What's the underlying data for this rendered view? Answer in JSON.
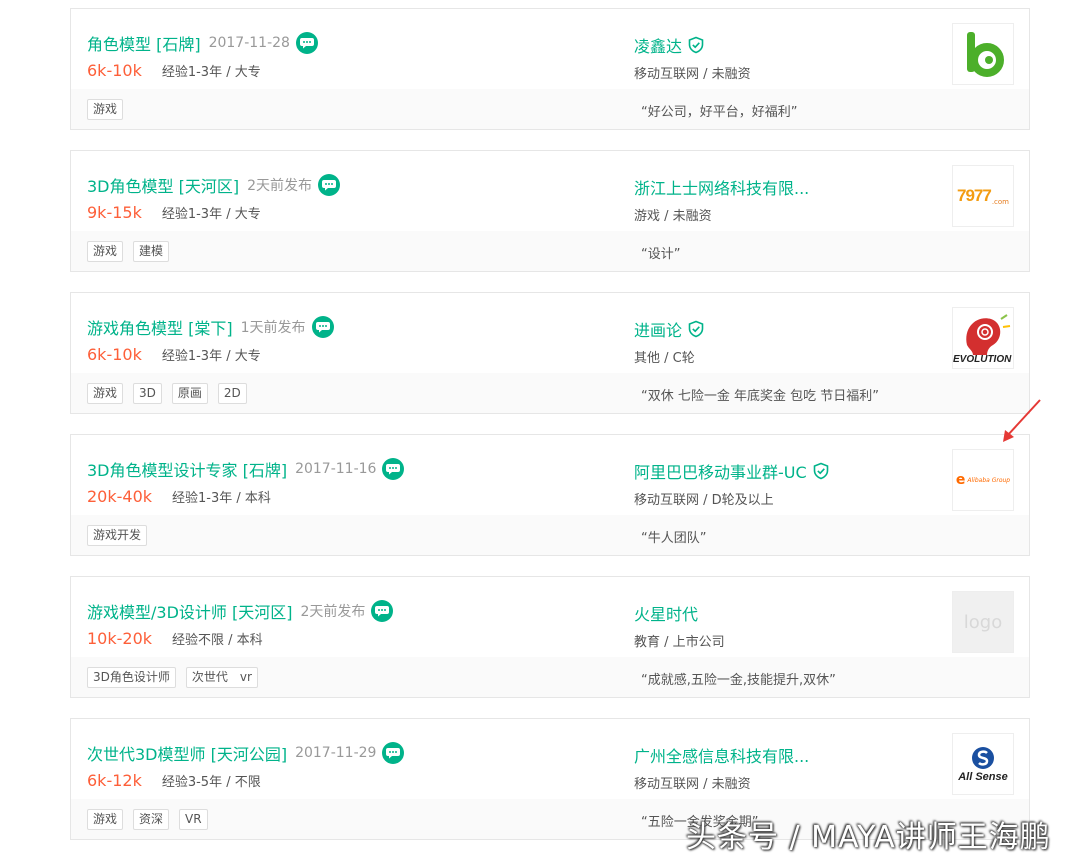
{
  "colors": {
    "accent": "#00b38a",
    "salary": "#fd5f39",
    "arrow": "#e53935"
  },
  "jobs": [
    {
      "position": "角色模型 [石牌]",
      "time": "2017-11-28",
      "salary": "6k-10k",
      "requirement": "经验1-3年 / 大专",
      "company": "凌鑫达",
      "verified": true,
      "industry": "移动互联网 / 未融资",
      "logo": "bc-green-logo",
      "tags": [
        "游戏"
      ],
      "slogan": "“好公司，好平台，好福利”"
    },
    {
      "position": "3D角色模型 [天河区]",
      "time": "2天前发布",
      "salary": "9k-15k",
      "requirement": "经验1-3年 / 大专",
      "company": "浙江上士网络科技有限...",
      "verified": false,
      "industry": "游戏 / 未融资",
      "logo": "7977-logo",
      "logo_text": "7977",
      "logo_sub": ".com",
      "tags": [
        "游戏",
        "建模"
      ],
      "slogan": "“设计”"
    },
    {
      "position": "游戏角色模型 [棠下]",
      "time": "1天前发布",
      "salary": "6k-10k",
      "requirement": "经验1-3年 / 大专",
      "company": "进画论",
      "verified": true,
      "industry": "其他 / C轮",
      "logo": "evolution-logo",
      "logo_text": "EVOLUTION",
      "tags": [
        "游戏",
        "3D",
        "原画",
        "2D"
      ],
      "slogan": "“双休 七险一金 年底奖金 包吃 节日福利”"
    },
    {
      "position": "3D角色模型设计专家 [石牌]",
      "time": "2017-11-16",
      "salary": "20k-40k",
      "requirement": "经验1-3年 / 本科",
      "company": "阿里巴巴移动事业群-UC",
      "verified": true,
      "industry": "移动互联网 / D轮及以上",
      "logo": "alibaba-logo",
      "logo_text": "Alibaba Group",
      "tags": [
        "游戏开发"
      ],
      "slogan": "“牛人团队”"
    },
    {
      "position": "游戏模型/3D设计师 [天河区]",
      "time": "2天前发布",
      "salary": "10k-20k",
      "requirement": "经验不限 / 本科",
      "company": "火星时代",
      "verified": false,
      "industry": "教育 / 上市公司",
      "logo": "placeholder-logo",
      "logo_text": "logo",
      "tags": [
        "3D角色设计师",
        "次世代　vr"
      ],
      "slogan": "“成就感,五险一金,技能提升,双休”"
    },
    {
      "position": "次世代3D模型师 [天河公园]",
      "time": "2017-11-29",
      "salary": "6k-12k",
      "requirement": "经验3-5年 / 不限",
      "company": "广州全感信息科技有限...",
      "verified": false,
      "industry": "移动互联网 / 未融资",
      "logo": "allsense-logo",
      "logo_text": "All Sense",
      "tags": [
        "游戏",
        "资深",
        "VR"
      ],
      "slogan": "“五险一金发奖金期”"
    }
  ],
  "watermark": "头条号 / MAYA讲师王海鹏"
}
